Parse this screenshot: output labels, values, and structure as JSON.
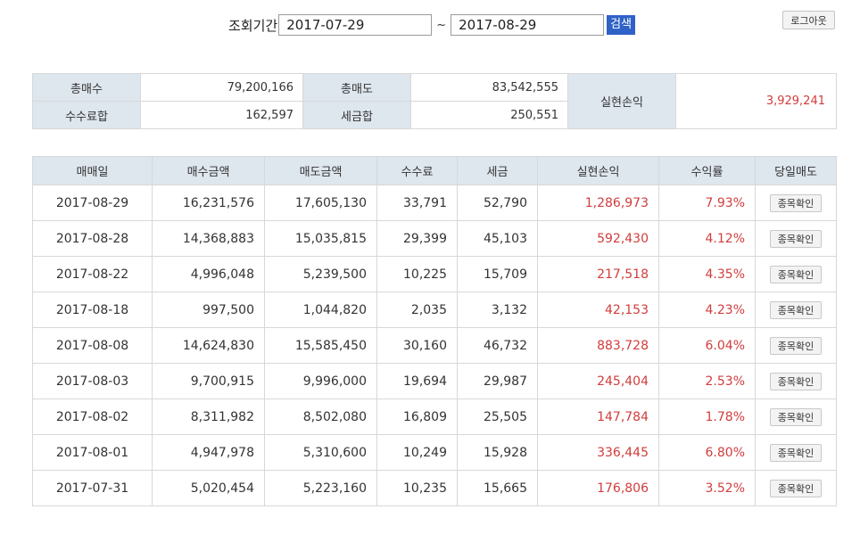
{
  "search": {
    "label": "조회기간",
    "start_date": "2017-07-29",
    "separator": "~",
    "end_date": "2017-08-29",
    "button_label": "검색"
  },
  "logout_label": "로그아웃",
  "summary": {
    "total_buy_label": "총매수",
    "total_buy": "79,200,166",
    "total_sell_label": "총매도",
    "total_sell": "83,542,555",
    "realized_label": "실현손익",
    "realized": "3,929,241",
    "fee_label": "수수료합",
    "fee": "162,597",
    "tax_label": "세금합",
    "tax": "250,551"
  },
  "table": {
    "headers": [
      "매매일",
      "매수금액",
      "매도금액",
      "수수료",
      "세금",
      "실현손익",
      "수익률",
      "당일매도"
    ],
    "button_label": "종목확인",
    "rows": [
      {
        "date": "2017-08-29",
        "buy": "16,231,576",
        "sell": "17,605,130",
        "fee": "33,791",
        "tax": "52,790",
        "profit": "1,286,973",
        "rate": "7.93%"
      },
      {
        "date": "2017-08-28",
        "buy": "14,368,883",
        "sell": "15,035,815",
        "fee": "29,399",
        "tax": "45,103",
        "profit": "592,430",
        "rate": "4.12%"
      },
      {
        "date": "2017-08-22",
        "buy": "4,996,048",
        "sell": "5,239,500",
        "fee": "10,225",
        "tax": "15,709",
        "profit": "217,518",
        "rate": "4.35%"
      },
      {
        "date": "2017-08-18",
        "buy": "997,500",
        "sell": "1,044,820",
        "fee": "2,035",
        "tax": "3,132",
        "profit": "42,153",
        "rate": "4.23%"
      },
      {
        "date": "2017-08-08",
        "buy": "14,624,830",
        "sell": "15,585,450",
        "fee": "30,160",
        "tax": "46,732",
        "profit": "883,728",
        "rate": "6.04%"
      },
      {
        "date": "2017-08-03",
        "buy": "9,700,915",
        "sell": "9,996,000",
        "fee": "19,694",
        "tax": "29,987",
        "profit": "245,404",
        "rate": "2.53%"
      },
      {
        "date": "2017-08-02",
        "buy": "8,311,982",
        "sell": "8,502,080",
        "fee": "16,809",
        "tax": "25,505",
        "profit": "147,784",
        "rate": "1.78%"
      },
      {
        "date": "2017-08-01",
        "buy": "4,947,978",
        "sell": "5,310,600",
        "fee": "10,249",
        "tax": "15,928",
        "profit": "336,445",
        "rate": "6.80%"
      },
      {
        "date": "2017-07-31",
        "buy": "5,020,454",
        "sell": "5,223,160",
        "fee": "10,235",
        "tax": "15,665",
        "profit": "176,806",
        "rate": "3.52%"
      }
    ]
  },
  "colors": {
    "accent_blue": "#2f62c6",
    "header_bg": "#dee6ee",
    "profit_red": "#d23c3c",
    "border": "#d8d8d8"
  }
}
